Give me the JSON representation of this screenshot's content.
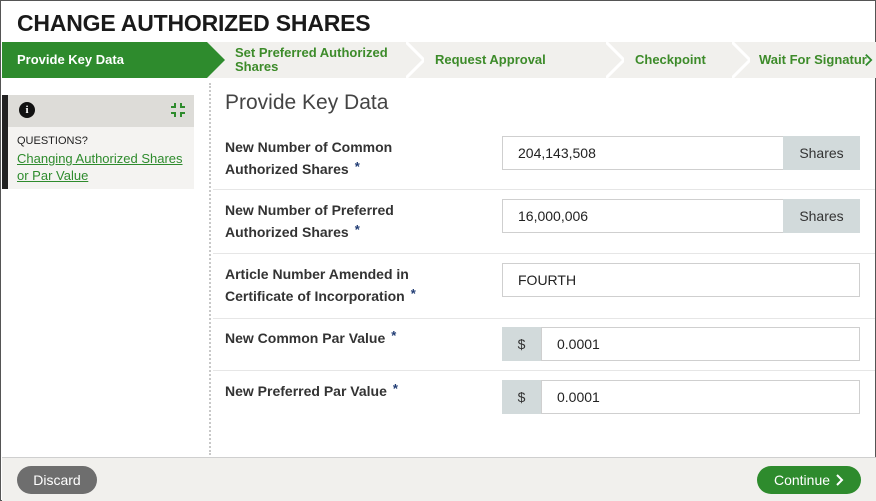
{
  "title": "CHANGE AUTHORIZED SHARES",
  "steps": [
    {
      "label": "Provide Key Data",
      "active": true
    },
    {
      "label": "Set Preferred Authorized Shares",
      "active": false
    },
    {
      "label": "Request Approval",
      "active": false
    },
    {
      "label": "Checkpoint",
      "active": false
    },
    {
      "label": "Wait For Signatur",
      "active": false
    }
  ],
  "sidebar": {
    "questions_label": "QUESTIONS?",
    "link_label": "Changing Authorized Shares or Par Value"
  },
  "section_title": "Provide Key Data",
  "fields": [
    {
      "label_line1": "New Number of Common",
      "label_line2": "Authorized Shares",
      "value": "204,143,508",
      "addon": "Shares"
    },
    {
      "label_line1": "New Number of Preferred",
      "label_line2": "Authorized Shares",
      "value": "16,000,006",
      "addon": "Shares"
    },
    {
      "label_line1": "Article Number Amended in",
      "label_line2": "Certificate of Incorporation",
      "value": "FOURTH"
    },
    {
      "label_line1": "New Common Par Value",
      "prefix": "$",
      "value": "0.0001"
    },
    {
      "label_line1": "New Preferred Par Value",
      "prefix": "$",
      "value": "0.0001"
    }
  ],
  "required_mark": "*",
  "footer": {
    "discard_label": "Discard",
    "continue_label": "Continue"
  },
  "colors": {
    "accent": "#2e8b2d",
    "addon": "#d2dadb",
    "required": "#1f3b73"
  }
}
